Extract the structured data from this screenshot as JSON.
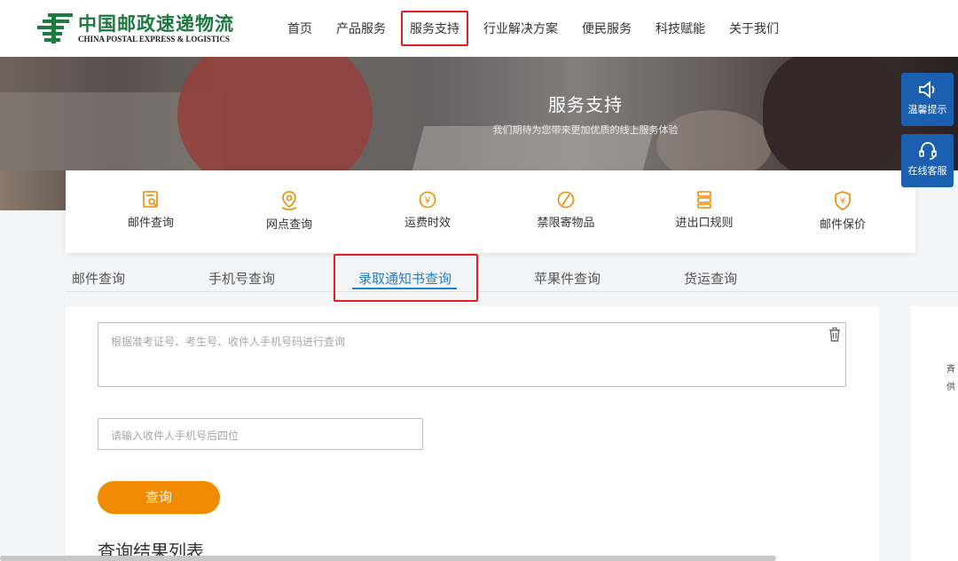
{
  "header": {
    "logo_cn": "中国邮政速递物流",
    "logo_en": "CHINA POSTAL EXPRESS & LOGISTICS",
    "nav": [
      "首页",
      "产品服务",
      "服务支持",
      "行业解决方案",
      "便民服务",
      "科技赋能",
      "关于我们"
    ]
  },
  "banner": {
    "title": "服务支持",
    "subtitle": "我们期待为您带来更加优质的线上服务体验"
  },
  "services": [
    {
      "label": "邮件查询",
      "icon": "mail-search-icon"
    },
    {
      "label": "网点查询",
      "icon": "location-pin-icon"
    },
    {
      "label": "运费时效",
      "icon": "yuan-clock-icon"
    },
    {
      "label": "禁限寄物品",
      "icon": "prohibited-icon"
    },
    {
      "label": "进出口规则",
      "icon": "rules-icon"
    },
    {
      "label": "邮件保价",
      "icon": "shield-yuan-icon"
    }
  ],
  "side": {
    "notice": "温馨提示",
    "service": "在线客服"
  },
  "tabs": [
    "邮件查询",
    "手机号查询",
    "录取通知书查询",
    "苹果件查询",
    "货运查询"
  ],
  "form": {
    "textarea_placeholder": "根据准考证号、考生号、收件人手机号码进行查询",
    "phone_placeholder": "请输入收件人手机号后四位",
    "query_button": "查询",
    "results_title": "查询结果列表"
  },
  "right_panel": {
    "line1": "斉",
    "line2": "供"
  },
  "colors": {
    "brand_green": "#1c7a3f",
    "accent_blue": "#1f7fd6",
    "side_blue": "#1b5fb0",
    "button_orange": "#f08a00",
    "icon_orange": "#f08a00",
    "highlight_red": "#e02020"
  }
}
